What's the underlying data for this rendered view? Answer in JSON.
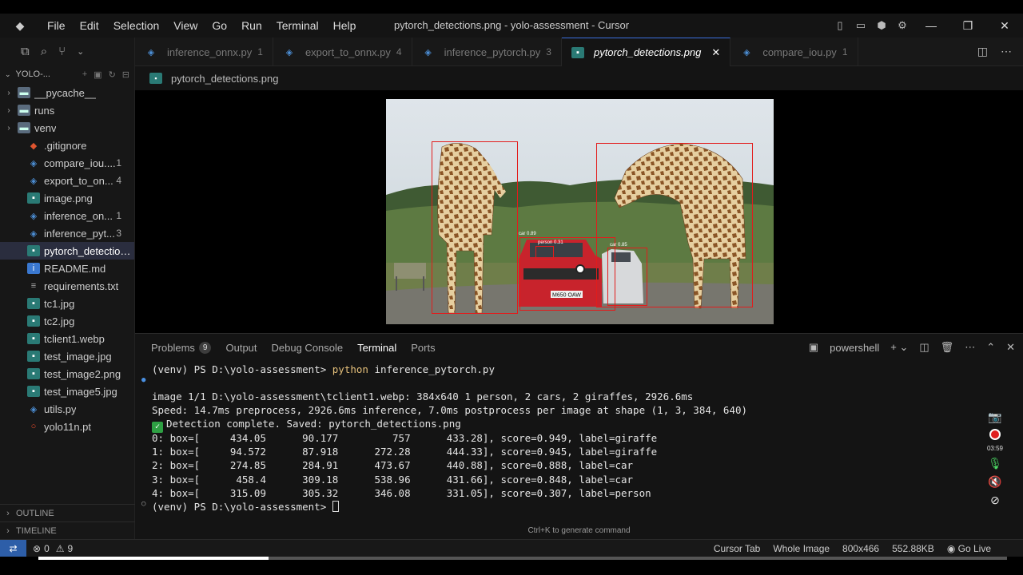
{
  "window": {
    "title": "pytorch_detections.png - yolo-assessment - Cursor"
  },
  "menu": [
    "File",
    "Edit",
    "Selection",
    "View",
    "Go",
    "Run",
    "Terminal",
    "Help"
  ],
  "explorer": {
    "root": "YOLO-...",
    "items": [
      {
        "label": "__pycache__",
        "kind": "folder",
        "badge": ""
      },
      {
        "label": "runs",
        "kind": "folder",
        "badge": ""
      },
      {
        "label": "venv",
        "kind": "folder",
        "badge": ""
      },
      {
        "label": ".gitignore",
        "kind": "git",
        "badge": ""
      },
      {
        "label": "compare_iou....",
        "kind": "python",
        "badge": "1"
      },
      {
        "label": "export_to_on...",
        "kind": "python",
        "badge": "4"
      },
      {
        "label": "image.png",
        "kind": "image",
        "badge": ""
      },
      {
        "label": "inference_on...",
        "kind": "python",
        "badge": "1"
      },
      {
        "label": "inference_pyt...",
        "kind": "python",
        "badge": "3"
      },
      {
        "label": "pytorch_detection...",
        "kind": "image",
        "badge": ""
      },
      {
        "label": "README.md",
        "kind": "info",
        "badge": ""
      },
      {
        "label": "requirements.txt",
        "kind": "text",
        "badge": ""
      },
      {
        "label": "tc1.jpg",
        "kind": "image",
        "badge": ""
      },
      {
        "label": "tc2.jpg",
        "kind": "image",
        "badge": ""
      },
      {
        "label": "tclient1.webp",
        "kind": "image",
        "badge": ""
      },
      {
        "label": "test_image.jpg",
        "kind": "image",
        "badge": ""
      },
      {
        "label": "test_image2.png",
        "kind": "image",
        "badge": ""
      },
      {
        "label": "test_image5.jpg",
        "kind": "image",
        "badge": ""
      },
      {
        "label": "utils.py",
        "kind": "python",
        "badge": ""
      },
      {
        "label": "yolo11n.pt",
        "kind": "torch",
        "badge": ""
      }
    ],
    "outline": "OUTLINE",
    "timeline": "TIMELINE"
  },
  "tabs": [
    {
      "label": "inference_onnx.py",
      "badge": "1",
      "kind": "python"
    },
    {
      "label": "export_to_onnx.py",
      "badge": "4",
      "kind": "python"
    },
    {
      "label": "inference_pytorch.py",
      "badge": "3",
      "kind": "python"
    },
    {
      "label": "pytorch_detections.png",
      "badge": "",
      "kind": "image"
    },
    {
      "label": "compare_iou.py",
      "badge": "1",
      "kind": "python"
    }
  ],
  "breadcrumb": "pytorch_detections.png",
  "image_view": {
    "plate": "M650 OAW",
    "labels": [
      "car 0.89",
      "person 0.31",
      "car 0.85"
    ]
  },
  "panel": {
    "tabs": [
      {
        "label": "Problems",
        "count": "9"
      },
      {
        "label": "Output",
        "count": ""
      },
      {
        "label": "Debug Console",
        "count": ""
      },
      {
        "label": "Terminal",
        "count": ""
      },
      {
        "label": "Ports",
        "count": ""
      }
    ],
    "shell": "powershell"
  },
  "terminal": {
    "prompt1": "(venv) PS D:\\yolo-assessment> ",
    "cmd_kw": "python",
    "cmd_rest": " inference_pytorch.py",
    "lines": [
      "image 1/1 D:\\yolo-assessment\\tclient1.webp: 384x640 1 person, 2 cars, 2 giraffes, 2926.6ms",
      "Speed: 14.7ms preprocess, 2926.6ms inference, 7.0ms postprocess per image at shape (1, 3, 384, 640)",
      "Detection complete. Saved: pytorch_detections.png",
      "0: box=[     434.05      90.177         757      433.28], score=0.949, label=giraffe",
      "1: box=[     94.572      87.918      272.28      444.33], score=0.945, label=giraffe",
      "2: box=[     274.85      284.91      473.67      440.88], score=0.888, label=car",
      "3: box=[      458.4      309.18      538.96      431.66], score=0.848, label=car",
      "4: box=[     315.09      305.32      346.08      331.05], score=0.307, label=person"
    ],
    "prompt2": "(venv) PS D:\\yolo-assessment> ",
    "hint": "Ctrl+K to generate command"
  },
  "recorder": {
    "time": "03:59"
  },
  "status": {
    "errors": "0",
    "warnings": "9",
    "items": [
      "Cursor Tab",
      "Whole Image",
      "800x466",
      "552.88KB",
      "Go Live"
    ]
  }
}
